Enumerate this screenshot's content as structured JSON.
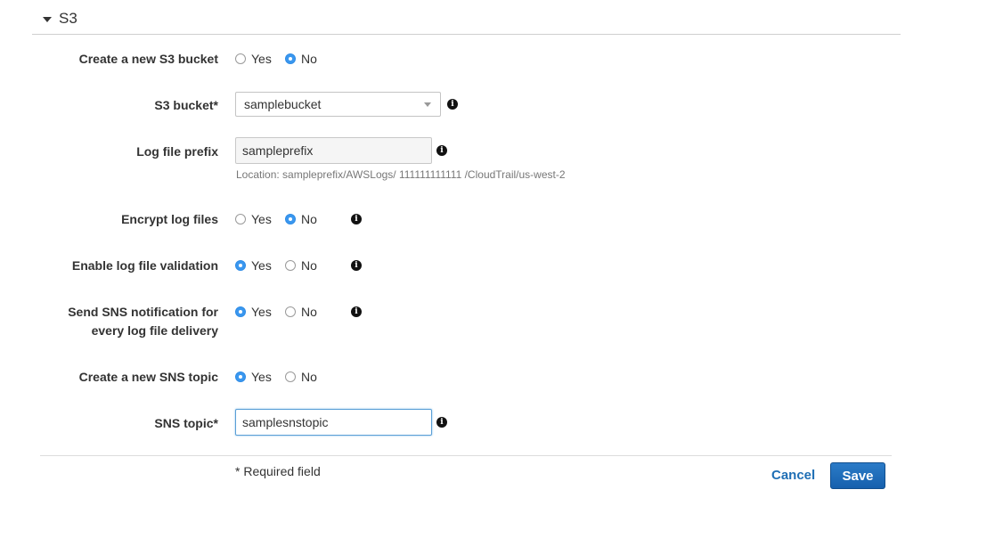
{
  "section": {
    "title": "S3"
  },
  "fields": {
    "create_bucket": {
      "label": "Create a new S3 bucket",
      "yes": "Yes",
      "no": "No",
      "selected": "No"
    },
    "s3_bucket": {
      "label": "S3 bucket*",
      "value": "samplebucket"
    },
    "log_prefix": {
      "label": "Log file prefix",
      "value": "sampleprefix",
      "hint": "Location: sampleprefix/AWSLogs/ 111111111111 /CloudTrail/us-west-2"
    },
    "encrypt": {
      "label": "Encrypt log files",
      "yes": "Yes",
      "no": "No",
      "selected": "No"
    },
    "validation": {
      "label": "Enable log file validation",
      "yes": "Yes",
      "no": "No",
      "selected": "Yes"
    },
    "sns_notify": {
      "label_line1": "Send SNS notification for",
      "label_line2": "every log file delivery",
      "yes": "Yes",
      "no": "No",
      "selected": "Yes"
    },
    "create_sns": {
      "label": "Create a new SNS topic",
      "yes": "Yes",
      "no": "No",
      "selected": "Yes"
    },
    "sns_topic": {
      "label": "SNS topic*",
      "value": "samplesnstopic"
    }
  },
  "footer": {
    "required_note": "* Required field",
    "cancel_label": "Cancel",
    "save_label": "Save"
  },
  "icons": {
    "info": "info-icon",
    "caret": "caret-down-icon"
  },
  "colors": {
    "accent": "#3a97ef",
    "link": "#1f6fb5",
    "primary_button": "#1a67b3"
  }
}
